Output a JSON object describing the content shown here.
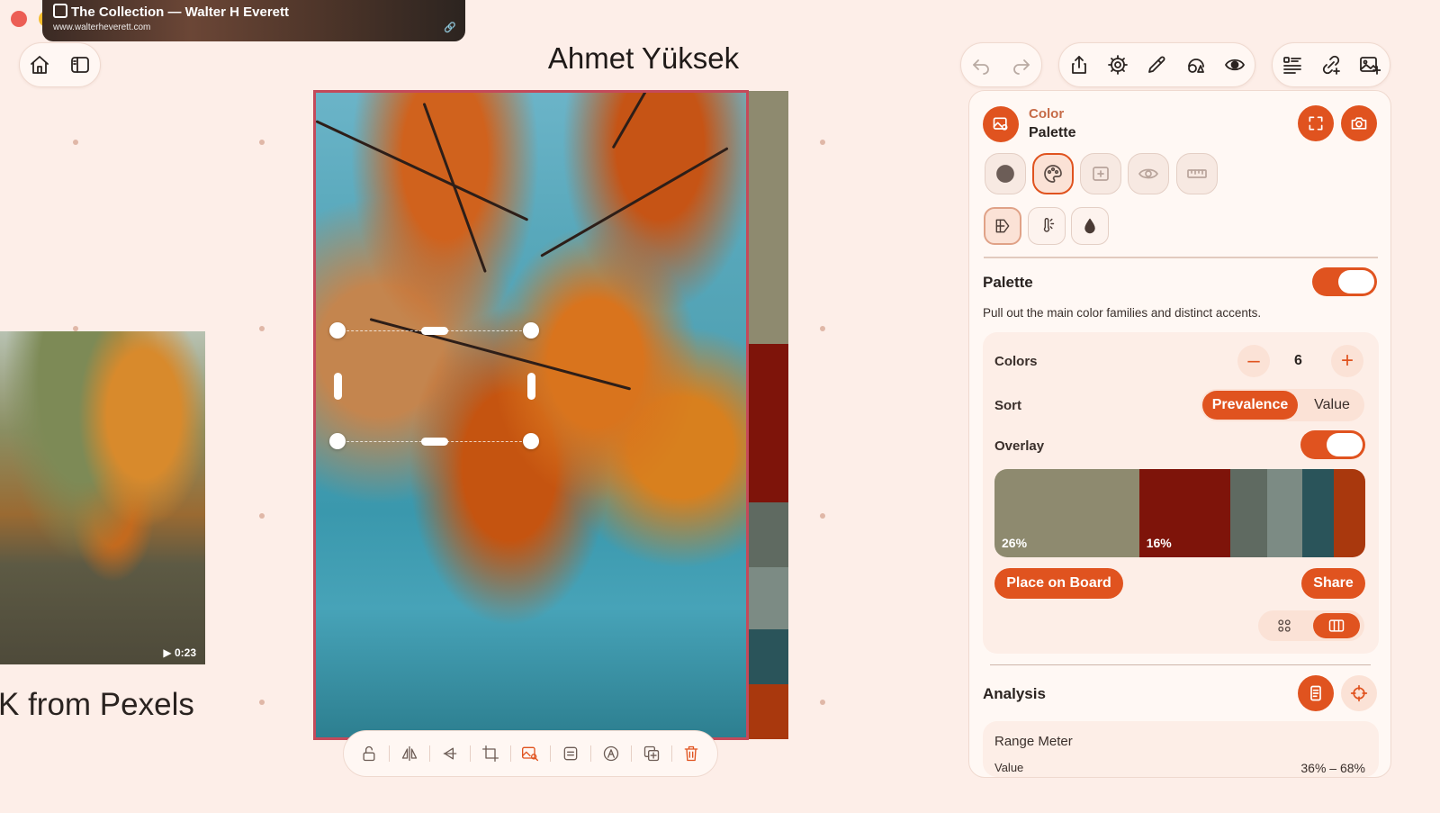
{
  "window": {
    "traffic_lights": {
      "close": "#ec5e55",
      "minimize": "#f5bd2e",
      "maximize": "#27c740"
    }
  },
  "tab": {
    "title": "The Collection — Walter H Everett",
    "url": "www.walterheverett.com"
  },
  "board": {
    "title": "Ahmet Yüksek",
    "left_caption": "K from Pexels",
    "video_duration": "▶ 0:23"
  },
  "palette_swatches": [
    "#8e8a6f",
    "#7e140a",
    "#5f6a61",
    "#7c8b84",
    "#2a545a",
    "#a9380d"
  ],
  "panel": {
    "header": {
      "line1": "Color",
      "line2": "Palette"
    },
    "palette_section": {
      "title": "Palette",
      "description": "Pull out the main color families and distinct accents.",
      "enabled": true
    },
    "colors": {
      "label": "Colors",
      "value": "6",
      "minus": "–",
      "plus": "+"
    },
    "sort": {
      "label": "Sort",
      "options": [
        "Prevalence",
        "Value"
      ],
      "selected": "Prevalence"
    },
    "overlay": {
      "label": "Overlay",
      "enabled": true,
      "segments": [
        {
          "color": "#8e8a6f",
          "share": 0.39,
          "label": "26%"
        },
        {
          "color": "#7e140a",
          "share": 0.245,
          "label": "16%"
        },
        {
          "color": "#5f6a61",
          "share": 0.1,
          "label": ""
        },
        {
          "color": "#7c8b84",
          "share": 0.095,
          "label": ""
        },
        {
          "color": "#2a545a",
          "share": 0.085,
          "label": ""
        },
        {
          "color": "#a9380d",
          "share": 0.085,
          "label": ""
        }
      ]
    },
    "actions": {
      "place": "Place on Board",
      "share": "Share"
    },
    "analysis": {
      "title": "Analysis",
      "range_meter": "Range Meter",
      "value_label": "Value",
      "value_range": "36% – 68%"
    }
  },
  "colors": {
    "accent": "#e0531f",
    "selection_border": "#c44a5a"
  }
}
